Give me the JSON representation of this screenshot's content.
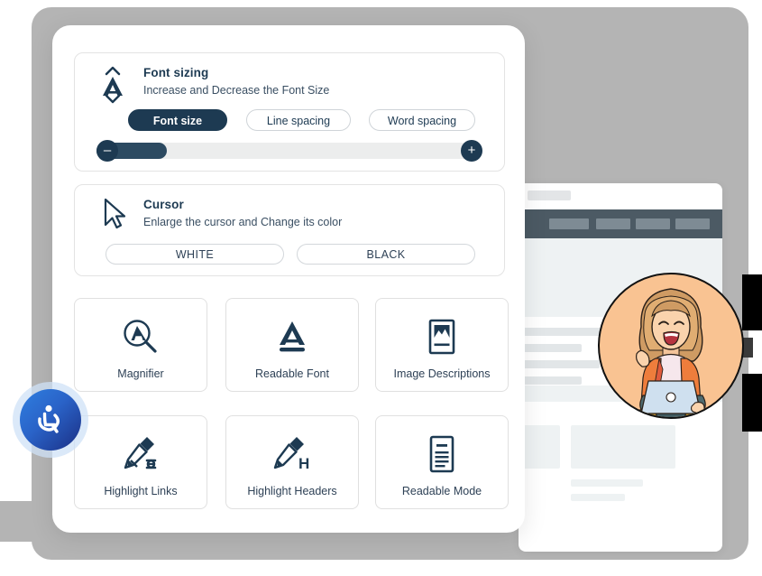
{
  "widget": {
    "font_sizing": {
      "icon": "font-size-arrows-icon",
      "title": "Font sizing",
      "subtitle": "Increase and Decrease the Font Size",
      "options": [
        {
          "label": "Font size",
          "active": true
        },
        {
          "label": "Line spacing",
          "active": false
        },
        {
          "label": "Word spacing",
          "active": false
        }
      ],
      "slider": {
        "decrease_label": "–",
        "increase_label": "+",
        "fill_percent": 18
      }
    },
    "cursor": {
      "icon": "mouse-pointer-icon",
      "title": "Cursor",
      "subtitle": "Enlarge the cursor and Change its color",
      "colors": [
        {
          "label": "WHITE"
        },
        {
          "label": "BLACK"
        }
      ]
    },
    "tiles": [
      {
        "label": "Magnifier",
        "icon": "magnifier-a-icon"
      },
      {
        "label": "Readable Font",
        "icon": "readable-font-a-icon"
      },
      {
        "label": "Image Descriptions",
        "icon": "image-frame-icon"
      },
      {
        "label": "Highlight Links",
        "icon": "highlighter-link-icon"
      },
      {
        "label": "Highlight Headers",
        "icon": "highlighter-h-icon"
      },
      {
        "label": "Readable Mode",
        "icon": "document-lines-icon"
      }
    ]
  },
  "accessibility_button": {
    "icon": "accessibility-wheelchair-icon",
    "core_color": "#2a63c8",
    "halo_color": "#cfe2f7"
  },
  "background_site": {
    "navbar_color": "#4c5a64",
    "nav_items": [
      "",
      "",
      "",
      ""
    ],
    "hero_color": "#eef2f3",
    "backdrop_color": "#b4b4b4"
  },
  "illustration": {
    "name": "woman-with-laptop-illustration",
    "circle_color": "#f9c392"
  },
  "theme": {
    "accent": "#1d3a52",
    "panel_bg": "#ffffff",
    "track": "#eceded"
  }
}
